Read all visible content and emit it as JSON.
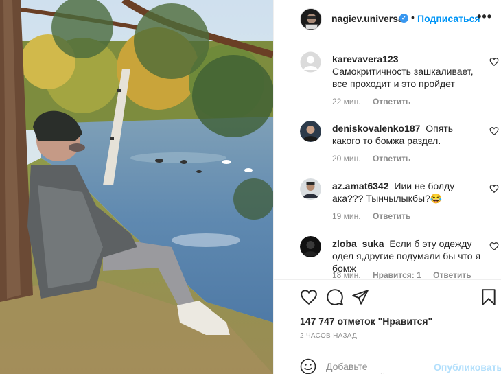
{
  "post": {
    "username": "nagiev.universal",
    "separator": "•",
    "follow_label": "Подписаться",
    "more_label": "•••",
    "image_alt": "photo",
    "accent_color": "#0095f6",
    "verified_color": "#3897f0",
    "avatar_text": "GEN"
  },
  "comments": [
    {
      "user": "karevavera123",
      "text": "Самокритичность зашкаливает, все проходит и это пройдет",
      "time": "22 мин.",
      "likes": "",
      "reply": "Ответить",
      "avatar": "default-avatar"
    },
    {
      "user": "deniskovalenko187",
      "text": "Опять какого то бомжа раздел.",
      "time": "20 мин.",
      "likes": "",
      "reply": "Ответить",
      "avatar": "photo-avatar"
    },
    {
      "user": "az.amat6342",
      "text": "Иии не болду ака??? Тынчылыкбы?😂",
      "time": "19 мин.",
      "likes": "",
      "reply": "Ответить",
      "avatar": "photo-avatar"
    },
    {
      "user": "zloba_suka",
      "text": "Если б эту одежду одел я,другие подумали бы что я бомж",
      "time": "18 мин.",
      "likes": "Нравится: 1",
      "reply": "Ответить",
      "avatar": "photo-avatar"
    }
  ],
  "actions": {
    "likes_text": "147 747 отметок \"Нравится\"",
    "time_ago": "2 ЧАСОВ НАЗАД",
    "comment_placeholder": "Добавьте комментарий...",
    "publish_label": "Опубликовать"
  }
}
